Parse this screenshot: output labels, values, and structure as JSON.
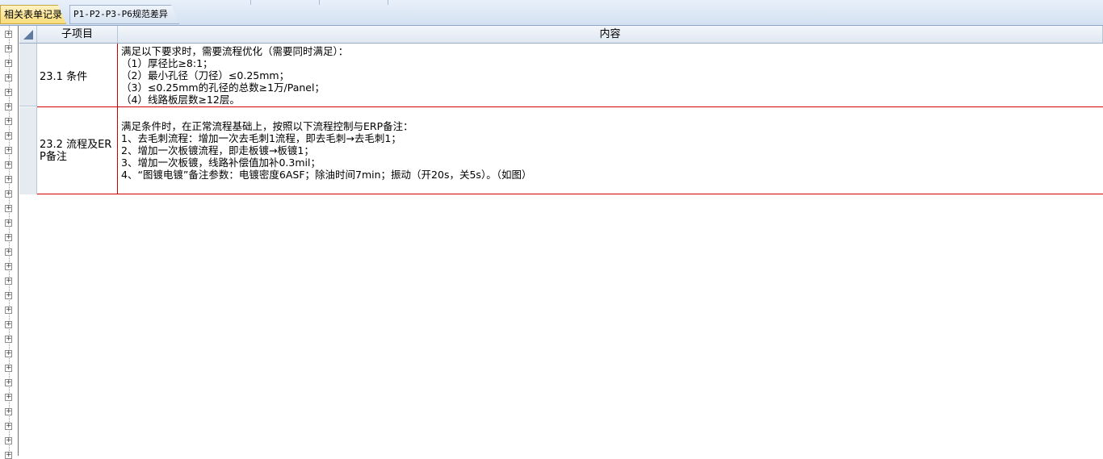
{
  "tabs": [
    {
      "label": "相关表单记录",
      "active": true
    },
    {
      "label": "P1-P2-P3-P6规范差异",
      "active": false
    }
  ],
  "grid": {
    "columns": [
      "子项目",
      "内容"
    ],
    "rows": [
      {
        "sub_item": "23.1 条件",
        "content": "满足以下要求时，需要流程优化（需要同时满足）：\n（1）厚径比≥8:1；\n（2）最小孔径（刀径）≤0.25mm；\n（3）≤0.25mm的孔径的总数≥1万/Panel；\n（4）线路板层数≥12层。"
      },
      {
        "sub_item": "23.2 流程及ERP备注",
        "content": "满足条件时，在正常流程基础上，按照以下流程控制与ERP备注：\n1、去毛刺流程：增加一次去毛刺1流程，即去毛刺→去毛刺1；\n2、增加一次板镀流程，即走板镀→板镀1；\n3、增加一次板镀，线路补偿值加补0.3mil；\n4、“图镀电镀”备注参数：电镀密度6ASF；除油时间7min；振动（开20s，关5s）。（如图）"
      }
    ]
  },
  "icons": {
    "tree_expand": "plus-box-icon",
    "select_all": "select-all-corner-icon"
  },
  "colors": {
    "row_separator": "#d10000",
    "active_tab": "#f9dc7a",
    "header_bg": "#dfe7f1"
  }
}
